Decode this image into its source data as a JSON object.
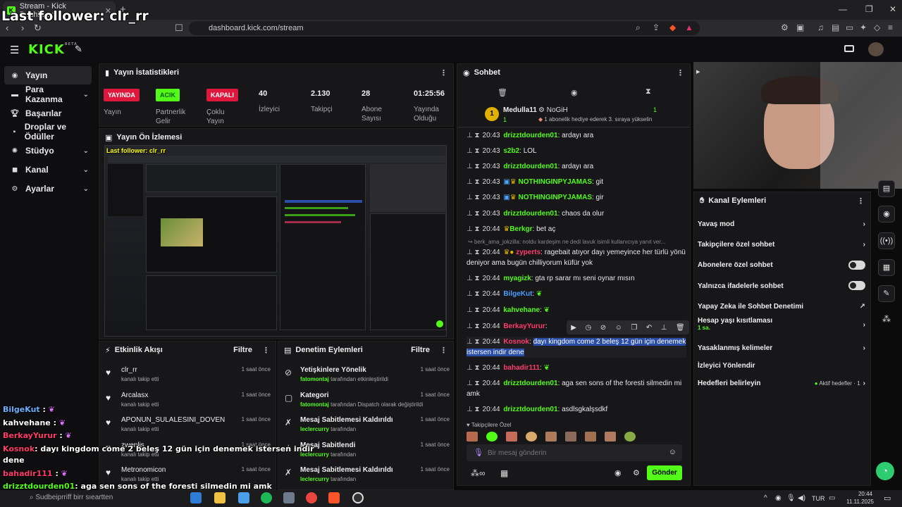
{
  "browser": {
    "tab_title": "Stream - Kick Dashboard",
    "url": "dashboard.kick.com/stream"
  },
  "overlay": {
    "title": "Last follower: clr_rr",
    "chat": [
      {
        "user": "BilgeKut",
        "text": ":"
      },
      {
        "user": "kahvehane",
        "text": ":"
      },
      {
        "user": "BerkayYurur",
        "text": ":"
      },
      {
        "user": "Kosnok",
        "text": ": dayı kingdom come 2 beleş 12 gün için denemek istersen indir"
      },
      {
        "user": "",
        "text": "dene"
      },
      {
        "user": "bahadir111",
        "text": ":"
      },
      {
        "user": "drizztdourden01",
        "text": ": aga sen sons of the foresti silmedin mi amk"
      }
    ]
  },
  "header": {
    "logo": "KICK",
    "beta": "BETA"
  },
  "sidebar": {
    "items": [
      {
        "label": "Yayın",
        "icon": "broadcast-icon"
      },
      {
        "label": "Para Kazanma",
        "icon": "money-icon"
      },
      {
        "label": "Başarılar",
        "icon": "trophy-icon"
      },
      {
        "label": "Droplar ve Ödüller",
        "icon": "gift-icon"
      },
      {
        "label": "Stüdyo",
        "icon": "studio-icon"
      },
      {
        "label": "Kanal",
        "icon": "channel-icon"
      },
      {
        "label": "Ayarlar",
        "icon": "gear-icon"
      }
    ]
  },
  "stats": {
    "title": "Yayın İstatistikleri",
    "live_badge": "YAYINDA",
    "live_label": "Yayın",
    "partner_badge": "ACIK",
    "partner_label": "Partnerlik Gelir",
    "multi_badge": "KAPALI",
    "multi_label": "Çoklu Yayın",
    "viewers": "40",
    "viewers_label": "İzleyici",
    "followers": "2.130",
    "followers_label": "Takipçi",
    "subs": "28",
    "subs_label": "Abone Sayısı",
    "uptime": "01:25:56",
    "uptime_label": "Yayında Olduğu"
  },
  "preview": {
    "title": "Yayın Ön İzlemesi",
    "overlay_text": "Last follower: clr_rr"
  },
  "chat": {
    "title": "Sohbet",
    "top_gifter_rank": "1",
    "top_gifter_name": "Medulla11",
    "top_gifter_count": "1",
    "second_name": "NoGiH",
    "second_count": "1",
    "second_note": "1 abonelik hediye ederek 3. sıraya yükselin",
    "reply_note": "berk_ama_jokzilla: noldu kardeşim ne dedi lavuk isimli kullanıcıya yanıt ver...",
    "messages": [
      {
        "time": "20:43",
        "user": "drizztdourden01",
        "text": "ardayı ara",
        "color": "#53fc18"
      },
      {
        "time": "20:43",
        "user": "s2b2",
        "text": "LOL",
        "color": "#53fc18"
      },
      {
        "time": "20:43",
        "user": "drizztdourden01",
        "text": "ardayı ara",
        "color": "#53fc18"
      },
      {
        "time": "20:43",
        "user": "NOTHINGINPYJAMAS",
        "text": "git",
        "color": "#53fc18"
      },
      {
        "time": "20:43",
        "user": "NOTHINGINPYJAMAS",
        "text": "gir",
        "color": "#53fc18"
      },
      {
        "time": "20:43",
        "user": "drizztdourden01",
        "text": "chaos da olur",
        "color": "#53fc18"
      },
      {
        "time": "20:44",
        "user": "Berkgr",
        "text": "bet aç",
        "color": "#53fc18"
      },
      {
        "time": "20:44",
        "user": "zyperts",
        "text": "ragebait atıyor dayı yemeyince her türlü yönü deniyor ama bugün chilliyorum küfür yok",
        "color": "#ff3b6b"
      },
      {
        "time": "20:44",
        "user": "myagizk",
        "text": "gta rp sarar mı seni oynar mısın",
        "color": "#53fc18"
      },
      {
        "time": "20:44",
        "user": "BilgeKut",
        "text": "",
        "color": "#4a9cff"
      },
      {
        "time": "20:44",
        "user": "kahvehane",
        "text": "",
        "color": "#53fc18"
      },
      {
        "time": "20:44",
        "user": "BerkayYurur",
        "text": "",
        "color": "#ff3b6b"
      },
      {
        "time": "20:44",
        "user": "Kosnok",
        "text": "dayı kingdom come 2 beleş 12 gün için denemek istersen indir dene",
        "color": "#ff3b6b"
      },
      {
        "time": "20:44",
        "user": "bahadir111",
        "text": "",
        "color": "#ff3b6b"
      },
      {
        "time": "20:44",
        "user": "drizztdourden01",
        "text": "aga sen sons of the foresti silmedin mi amk",
        "color": "#53fc18"
      },
      {
        "time": "20:44",
        "user": "drizztdourden01",
        "text": "asdlsgkalşsdkf",
        "color": "#53fc18"
      }
    ],
    "followers_only": "Takipçilere Özel",
    "input_placeholder": "Bir mesaj gönderin",
    "send": "Gönder"
  },
  "activity": {
    "title": "Etkinlik Akışı",
    "filter": "Filtre",
    "items": [
      {
        "name": "clr_rr",
        "sub": "kanalı takip etti",
        "ago": "1 saat önce"
      },
      {
        "name": "Arcalasx",
        "sub": "kanalı takip etti",
        "ago": "1 saat önce"
      },
      {
        "name": "APONUN_SULALESINI_DOVEN",
        "sub": "kanalı takip etti",
        "ago": "1 saat önce"
      },
      {
        "name": "zwenlis",
        "sub": "kanalı takip etti",
        "ago": "1 saat önce"
      },
      {
        "name": "Metronomicon",
        "sub": "kanalı takip etti",
        "ago": "1 saat önce"
      }
    ]
  },
  "moderation": {
    "title": "Denetim Eylemleri",
    "filter": "Filtre",
    "items": [
      {
        "name": "Yetişkinlere Yönelik",
        "actor": "fatomontaj",
        "sub": "tarafından etkinleştirildi",
        "ago": "1 saat önce",
        "icon": "eye-off-icon"
      },
      {
        "name": "Kategori",
        "actor": "fatomontaj",
        "sub": "tarafından Dispatch olarak değiştirildi",
        "ago": "1 saat önce",
        "icon": "category-icon"
      },
      {
        "name": "Mesaj Sabitlemesi Kaldırıldı",
        "actor": "leclercurry",
        "sub": "tarafından",
        "ago": "1 saat önce",
        "icon": "unpin-icon"
      },
      {
        "name": "Mesaj Sabitlendi",
        "actor": "leclercurry",
        "sub": "tarafından",
        "ago": "1 saat önce",
        "icon": "pin-icon"
      },
      {
        "name": "Mesaj Sabitlemesi Kaldırıldı",
        "actor": "leclercurry",
        "sub": "tarafından",
        "ago": "1 saat önce",
        "icon": "unpin-icon"
      }
    ]
  },
  "channel_actions": {
    "title": "Kanal Eylemleri",
    "items": [
      {
        "label": "Yavaş mod",
        "kind": "chevron"
      },
      {
        "label": "Takipçilere özel sohbet",
        "kind": "chevron"
      },
      {
        "label": "Abonelere özel sohbet",
        "kind": "toggle"
      },
      {
        "label": "Yalnızca ifadelerle sohbet",
        "kind": "toggle"
      },
      {
        "label": "Yapay Zeka ile Sohbet Denetimi",
        "kind": "external"
      },
      {
        "label": "Hesap yaşı kısıtlaması",
        "kind": "chevron",
        "sub": "1 sa."
      },
      {
        "label": "Yasaklanmış kelimeler",
        "kind": "chevron"
      },
      {
        "label": "İzleyici Yönlendir",
        "kind": "none"
      },
      {
        "label": "Hedefleri belirleyin",
        "kind": "chevron",
        "sub": "Aktif hedefler · 1"
      }
    ]
  },
  "taskbar": {
    "search_placeholder": "Sudbeiprriff birr sıeartten",
    "lang": "TUR",
    "time": "20:44",
    "date": "11.11.2025"
  }
}
